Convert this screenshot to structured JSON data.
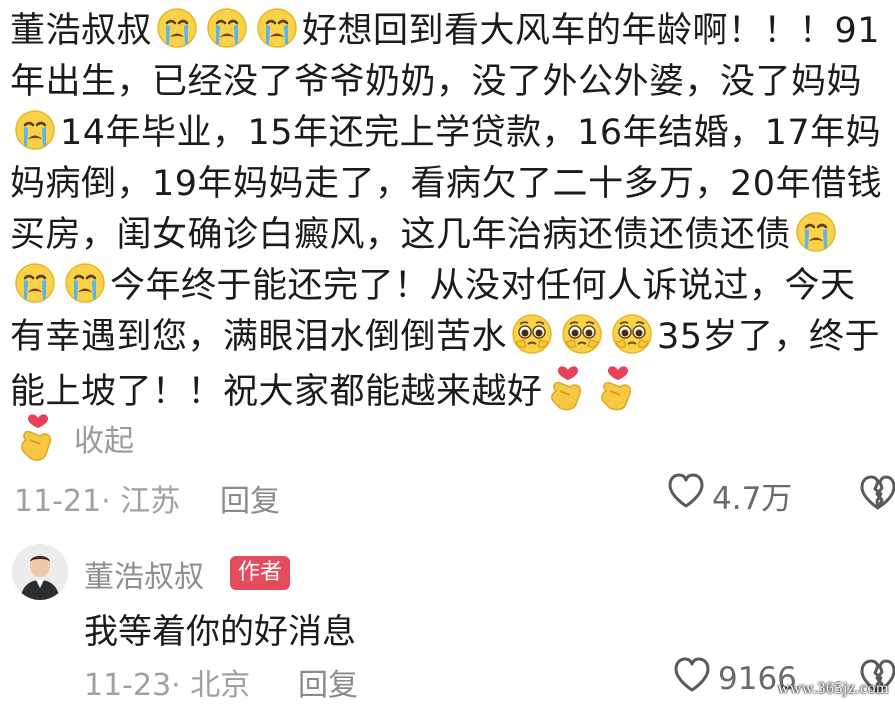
{
  "comment": {
    "segments": [
      {
        "type": "text",
        "value": "董浩叔叔"
      },
      {
        "type": "emoji",
        "icon": "crying-face-icon"
      },
      {
        "type": "emoji",
        "icon": "crying-face-icon"
      },
      {
        "type": "emoji",
        "icon": "crying-face-icon"
      },
      {
        "type": "text",
        "value": "好想回到看大风车的年龄啊！！！91年出生，已经没了爷爷奶奶，没了外公外婆，没了妈妈"
      },
      {
        "type": "emoji",
        "icon": "crying-face-icon"
      },
      {
        "type": "text",
        "value": "14年毕业，15年还完上学贷款，16年结婚，17年妈妈病倒，19年妈妈走了，看病欠了二十多万，20年借钱买房，闺女确诊白癜风，这几年治病还债还债还债"
      },
      {
        "type": "emoji",
        "icon": "crying-face-icon"
      },
      {
        "type": "emoji",
        "icon": "crying-face-icon"
      },
      {
        "type": "emoji",
        "icon": "crying-face-icon"
      },
      {
        "type": "text",
        "value": "今年终于能还完了！从没对任何人诉说过，今天有幸遇到您，满眼泪水倒倒苦水"
      },
      {
        "type": "emoji",
        "icon": "pleading-face-icon"
      },
      {
        "type": "emoji",
        "icon": "pleading-face-icon"
      },
      {
        "type": "emoji",
        "icon": "pleading-face-icon"
      },
      {
        "type": "text",
        "value": "35岁了，终于能上坡了！！祝大家都能越来越好"
      },
      {
        "type": "emoji",
        "icon": "finger-heart-icon"
      },
      {
        "type": "emoji",
        "icon": "finger-heart-icon"
      }
    ],
    "collapse_label": "收起",
    "date_location": "11-21· 江苏",
    "reply_label": "回复",
    "like_count": "4.7万"
  },
  "reply": {
    "author": "董浩叔叔",
    "badge": "作者",
    "text": "我等着你的好消息",
    "date_location": "11-23· 北京",
    "reply_label": "回复",
    "like_count": "9166"
  },
  "watermark": "www.365jz.com",
  "colors": {
    "badge": "#e24c5b",
    "meta_text": "#a0a0a0",
    "main_text": "#1b1b1b"
  }
}
